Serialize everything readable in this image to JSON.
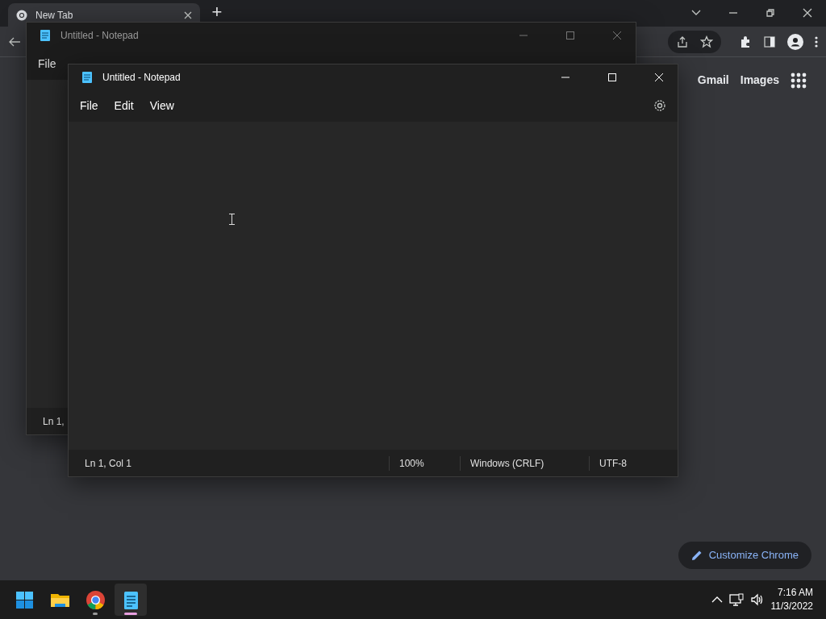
{
  "browser": {
    "tab": {
      "title": "New Tab"
    },
    "new_tab_button": "+",
    "links": [
      "Gmail",
      "Images"
    ],
    "customize_button": "Customize Chrome"
  },
  "windows": [
    {
      "title": "Untitled - Notepad",
      "active": false,
      "menu": [
        "File"
      ],
      "status": [
        "Ln 1,"
      ]
    },
    {
      "title": "Untitled - Notepad",
      "active": true,
      "menu": [
        "File",
        "Edit",
        "View"
      ],
      "status": [
        "Ln 1, Col 1",
        "100%",
        "Windows (CRLF)",
        "UTF-8"
      ]
    }
  ],
  "taskbar": {
    "apps": [
      {
        "kind": "start",
        "running": false,
        "active": false
      },
      {
        "kind": "explorer",
        "running": false,
        "active": false
      },
      {
        "kind": "chrome",
        "running": true,
        "active": false
      },
      {
        "kind": "notepad",
        "running": true,
        "active": true
      }
    ],
    "time": "7:16 AM",
    "date": "11/3/2022"
  }
}
